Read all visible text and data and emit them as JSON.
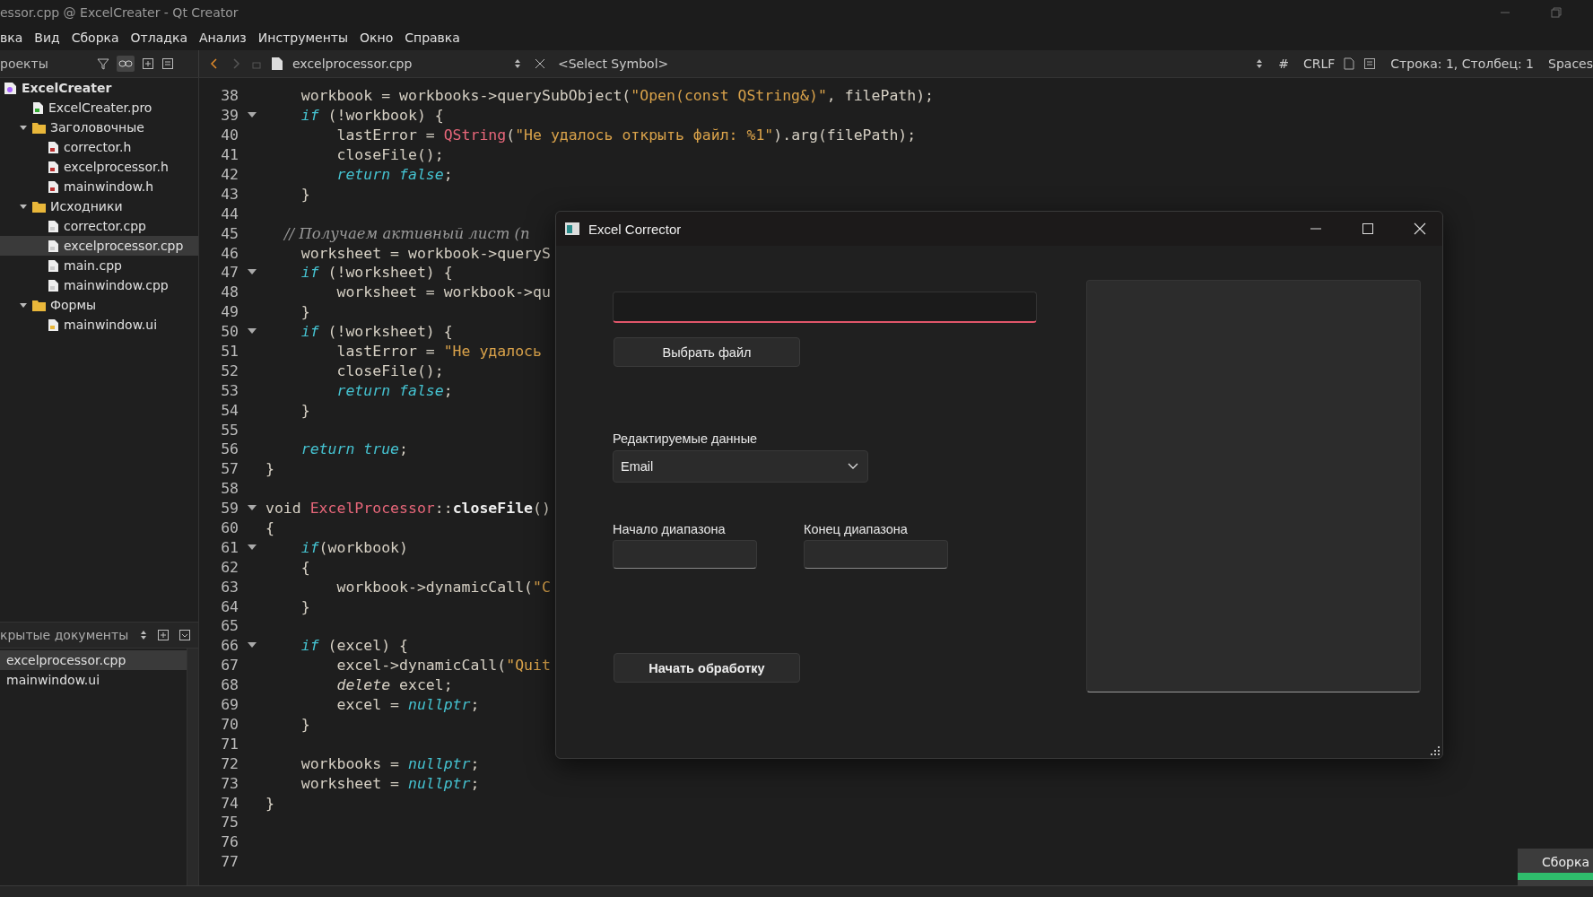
{
  "window": {
    "title": "essor.cpp @ ExcelCreater - Qt Creator"
  },
  "menu": [
    {
      "label": "вка"
    },
    {
      "label": "Вид"
    },
    {
      "label": "Сборка"
    },
    {
      "label": "Отладка"
    },
    {
      "label": "Анализ"
    },
    {
      "label": "Инструменты"
    },
    {
      "label": "Окно"
    },
    {
      "label": "Справка"
    }
  ],
  "toolbar": {
    "projects_selector": "роекты",
    "sync_editor": {
      "on": true
    },
    "file_tab": "excelprocessor.cpp",
    "symbol_selector": "<Select Symbol>",
    "hash": "#",
    "line_ending": "CRLF",
    "cursor_position": "Строка: 1, Столбец: 1",
    "indentation": "Spaces"
  },
  "project_tree": [
    {
      "label": "ExcelCreater",
      "kind": "project",
      "selected": false,
      "children": [
        {
          "label": "ExcelCreater.pro",
          "kind": "pro",
          "selected": false
        },
        {
          "label": "Заголовочные",
          "kind": "folder",
          "expanded": true,
          "selected": false,
          "children": [
            {
              "label": "corrector.h",
              "kind": "h",
              "selected": false
            },
            {
              "label": "excelprocessor.h",
              "kind": "h",
              "selected": false
            },
            {
              "label": "mainwindow.h",
              "kind": "h",
              "selected": false
            }
          ]
        },
        {
          "label": "Исходники",
          "kind": "folder",
          "expanded": true,
          "selected": false,
          "children": [
            {
              "label": "corrector.cpp",
              "kind": "cpp",
              "selected": false
            },
            {
              "label": "excelprocessor.cpp",
              "kind": "cpp",
              "selected": true
            },
            {
              "label": "main.cpp",
              "kind": "cpp",
              "selected": false
            },
            {
              "label": "mainwindow.cpp",
              "kind": "cpp",
              "selected": false
            }
          ]
        },
        {
          "label": "Формы",
          "kind": "folder",
          "expanded": true,
          "selected": false,
          "children": [
            {
              "label": "mainwindow.ui",
              "kind": "ui",
              "selected": false
            }
          ]
        }
      ]
    }
  ],
  "open_documents": {
    "title": "крытые документы",
    "items": [
      {
        "label": "excelprocessor.cpp",
        "selected": true
      },
      {
        "label": "mainwindow.ui",
        "selected": false
      }
    ]
  },
  "editor": {
    "lines": [
      {
        "number": "38",
        "fold": false,
        "tokens": [
          {
            "text": "    workbook = workbooks->querySubObject(",
            "kind": "plain"
          },
          {
            "text": "\"Open(const QString&)\"",
            "kind": "string"
          },
          {
            "text": ", filePath);",
            "kind": "plain"
          }
        ]
      },
      {
        "number": "39",
        "fold": true,
        "tokens": [
          {
            "text": "    if",
            "kind": "keyword"
          },
          {
            "text": " (!workbook) {",
            "kind": "plain"
          }
        ]
      },
      {
        "number": "40",
        "fold": false,
        "tokens": [
          {
            "text": "        lastError = ",
            "kind": "plain"
          },
          {
            "text": "QString",
            "kind": "type"
          },
          {
            "text": "(",
            "kind": "plain"
          },
          {
            "text": "\"Не удалось открыть файл: %1\"",
            "kind": "string"
          },
          {
            "text": ").arg(filePath);",
            "kind": "plain"
          }
        ]
      },
      {
        "number": "41",
        "fold": false,
        "tokens": [
          {
            "text": "        closeFile();",
            "kind": "plain"
          }
        ]
      },
      {
        "number": "42",
        "fold": false,
        "tokens": [
          {
            "text": "        return false",
            "kind": "keyword"
          },
          {
            "text": ";",
            "kind": "plain"
          }
        ]
      },
      {
        "number": "43",
        "fold": false,
        "tokens": [
          {
            "text": "    }",
            "kind": "plain"
          }
        ]
      },
      {
        "number": "44",
        "fold": false
      },
      {
        "number": "45",
        "fold": false,
        "tokens": [
          {
            "text": "    // Получаем активный лист (п",
            "kind": "comment"
          }
        ]
      },
      {
        "number": "46",
        "fold": false,
        "tokens": [
          {
            "text": "    worksheet = workbook->queryS",
            "kind": "plain"
          }
        ]
      },
      {
        "number": "47",
        "fold": true,
        "tokens": [
          {
            "text": "    if",
            "kind": "keyword"
          },
          {
            "text": " (!worksheet) {",
            "kind": "plain"
          }
        ]
      },
      {
        "number": "48",
        "fold": false,
        "tokens": [
          {
            "text": "        worksheet = workbook->qu",
            "kind": "plain"
          }
        ]
      },
      {
        "number": "49",
        "fold": false,
        "tokens": [
          {
            "text": "    }",
            "kind": "plain"
          }
        ]
      },
      {
        "number": "50",
        "fold": true,
        "tokens": [
          {
            "text": "    if",
            "kind": "keyword"
          },
          {
            "text": " (!worksheet) {",
            "kind": "plain"
          }
        ]
      },
      {
        "number": "51",
        "fold": false,
        "tokens": [
          {
            "text": "        lastError = ",
            "kind": "plain"
          },
          {
            "text": "\"Не удалось",
            "kind": "string"
          }
        ]
      },
      {
        "number": "52",
        "fold": false,
        "tokens": [
          {
            "text": "        closeFile();",
            "kind": "plain"
          }
        ]
      },
      {
        "number": "53",
        "fold": false,
        "tokens": [
          {
            "text": "        return false",
            "kind": "keyword"
          },
          {
            "text": ";",
            "kind": "plain"
          }
        ]
      },
      {
        "number": "54",
        "fold": false,
        "tokens": [
          {
            "text": "    }",
            "kind": "plain"
          }
        ]
      },
      {
        "number": "55",
        "fold": false
      },
      {
        "number": "56",
        "fold": false,
        "tokens": [
          {
            "text": "    return true",
            "kind": "keyword"
          },
          {
            "text": ";",
            "kind": "plain"
          }
        ]
      },
      {
        "number": "57",
        "fold": false,
        "tokens": [
          {
            "text": "}",
            "kind": "plain"
          }
        ]
      },
      {
        "number": "58",
        "fold": false
      },
      {
        "number": "59",
        "fold": true,
        "tokens": [
          {
            "text": "void ",
            "kind": "plain"
          },
          {
            "text": "ExcelProcessor",
            "kind": "type"
          },
          {
            "text": "::",
            "kind": "plain"
          },
          {
            "text": "closeFile",
            "kind": "decl"
          },
          {
            "text": "()",
            "kind": "plain"
          }
        ]
      },
      {
        "number": "60",
        "fold": false,
        "tokens": [
          {
            "text": "{",
            "kind": "plain"
          }
        ]
      },
      {
        "number": "61",
        "fold": true,
        "tokens": [
          {
            "text": "    if",
            "kind": "keyword"
          },
          {
            "text": "(workbook)",
            "kind": "plain"
          }
        ]
      },
      {
        "number": "62",
        "fold": false,
        "tokens": [
          {
            "text": "    {",
            "kind": "plain"
          }
        ]
      },
      {
        "number": "63",
        "fold": false,
        "tokens": [
          {
            "text": "        workbook->dynamicCall(",
            "kind": "plain"
          },
          {
            "text": "\"C",
            "kind": "string"
          }
        ]
      },
      {
        "number": "64",
        "fold": false,
        "tokens": [
          {
            "text": "    }",
            "kind": "plain"
          }
        ]
      },
      {
        "number": "65",
        "fold": false
      },
      {
        "number": "66",
        "fold": true,
        "tokens": [
          {
            "text": "    if",
            "kind": "keyword"
          },
          {
            "text": " (excel) {",
            "kind": "plain"
          }
        ]
      },
      {
        "number": "67",
        "fold": false,
        "tokens": [
          {
            "text": "        excel->dynamicCall(",
            "kind": "plain"
          },
          {
            "text": "\"Quit",
            "kind": "string"
          }
        ]
      },
      {
        "number": "68",
        "fold": false,
        "tokens": [
          {
            "text": "        delete",
            "kind": "italic"
          },
          {
            "text": " excel;",
            "kind": "plain"
          }
        ]
      },
      {
        "number": "69",
        "fold": false,
        "tokens": [
          {
            "text": "        excel = ",
            "kind": "plain"
          },
          {
            "text": "nullptr",
            "kind": "keyword"
          },
          {
            "text": ";",
            "kind": "plain"
          }
        ]
      },
      {
        "number": "70",
        "fold": false,
        "tokens": [
          {
            "text": "    }",
            "kind": "plain"
          }
        ]
      },
      {
        "number": "71",
        "fold": false
      },
      {
        "number": "72",
        "fold": false,
        "tokens": [
          {
            "text": "    workbooks = ",
            "kind": "plain"
          },
          {
            "text": "nullptr",
            "kind": "keyword"
          },
          {
            "text": ";",
            "kind": "plain"
          }
        ]
      },
      {
        "number": "73",
        "fold": false,
        "tokens": [
          {
            "text": "    worksheet = ",
            "kind": "plain"
          },
          {
            "text": "nullptr",
            "kind": "keyword"
          },
          {
            "text": ";",
            "kind": "plain"
          }
        ]
      },
      {
        "number": "74",
        "fold": false,
        "tokens": [
          {
            "text": "}",
            "kind": "plain"
          }
        ]
      },
      {
        "number": "75",
        "fold": false
      },
      {
        "number": "76",
        "fold": false
      },
      {
        "number": "77",
        "fold": false
      }
    ]
  },
  "dialog": {
    "title": "Excel Corrector",
    "file_field": {
      "focused": true
    },
    "choose_file_button": "Выбрать файл",
    "data_label": "Редактируемые данные",
    "data_select": {
      "value": "Email"
    },
    "range_start": {
      "label": "Начало диапазона"
    },
    "range_end": {
      "label": "Конец диапазона"
    },
    "start_button": "Начать обработку"
  },
  "build_progress": {
    "label": "Сборка",
    "level": 1
  }
}
